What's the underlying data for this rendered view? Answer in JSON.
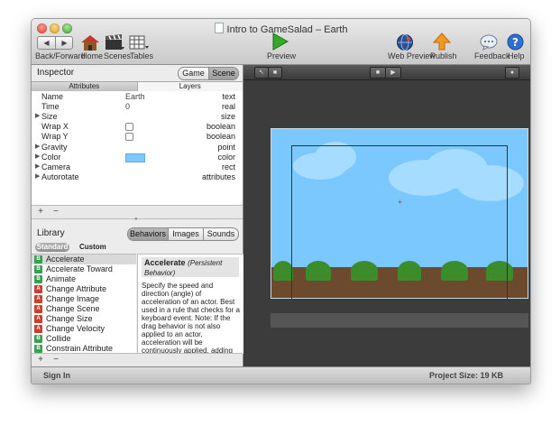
{
  "window": {
    "title": "Intro to GameSalad – Earth"
  },
  "toolbar": {
    "back_forward": "Back/Forward",
    "home": "Home",
    "scenes": "Scenes",
    "tables": "Tables",
    "preview": "Preview",
    "web_preview": "Web Preview",
    "publish": "Publish",
    "feedback": "Feedback",
    "help": "Help"
  },
  "inspector": {
    "title": "Inspector",
    "seg": [
      "Game",
      "Scene"
    ],
    "tabs": [
      "Attributes",
      "Layers"
    ],
    "rows": [
      {
        "name": "Name",
        "value": "Earth",
        "type": "text"
      },
      {
        "name": "Time",
        "value": "0",
        "type": "real"
      },
      {
        "name": "Size",
        "value": "",
        "type": "size"
      },
      {
        "name": "Wrap X",
        "value": "",
        "type": "boolean"
      },
      {
        "name": "Wrap Y",
        "value": "",
        "type": "boolean"
      },
      {
        "name": "Gravity",
        "value": "",
        "type": "point"
      },
      {
        "name": "Color",
        "value": "",
        "type": "color"
      },
      {
        "name": "Camera",
        "value": "",
        "type": "rect"
      },
      {
        "name": "Autorotate",
        "value": "",
        "type": "attributes"
      }
    ],
    "add": "+",
    "remove": "−"
  },
  "library": {
    "title": "Library",
    "seg": [
      "Behaviors",
      "Images",
      "Sounds"
    ],
    "sub": [
      "Standard",
      "Custom"
    ],
    "items": [
      {
        "badge": "B",
        "label": "Accelerate"
      },
      {
        "badge": "B",
        "label": "Accelerate Toward"
      },
      {
        "badge": "B",
        "label": "Animate"
      },
      {
        "badge": "A",
        "label": "Change Attribute"
      },
      {
        "badge": "A",
        "label": "Change Image"
      },
      {
        "badge": "A",
        "label": "Change Scene"
      },
      {
        "badge": "A",
        "label": "Change Size"
      },
      {
        "badge": "A",
        "label": "Change Velocity"
      },
      {
        "badge": "B",
        "label": "Collide"
      },
      {
        "badge": "B",
        "label": "Constrain Attribute"
      }
    ],
    "desc_title": "Accelerate",
    "desc_subtitle": "(Persistent Behavior)",
    "desc_body": "Specify the speed and direction (angle) of acceleration of an actor. Best used in a rule that checks for a keyboard event. Note: If the drag behavior is not also applied to an actor, acceleration will be continuously applied, adding greater and greater speed to the actor until it",
    "add": "+",
    "remove": "−"
  },
  "status": {
    "left": "Sign In",
    "right": "Project Size: 19 KB"
  },
  "colors": {
    "scene_color": "#7dc8ff",
    "behavior_badge": "#3aa050",
    "action_badge": "#c8402e"
  },
  "icons": {
    "back": "back-arrow-icon",
    "forward": "forward-arrow-icon",
    "home": "home-icon",
    "scenes": "clapperboard-icon",
    "tables": "table-icon",
    "preview": "play-icon",
    "web_preview": "globe-icon",
    "publish": "upload-arrow-icon",
    "feedback": "speech-bubble-icon",
    "help": "help-icon"
  }
}
